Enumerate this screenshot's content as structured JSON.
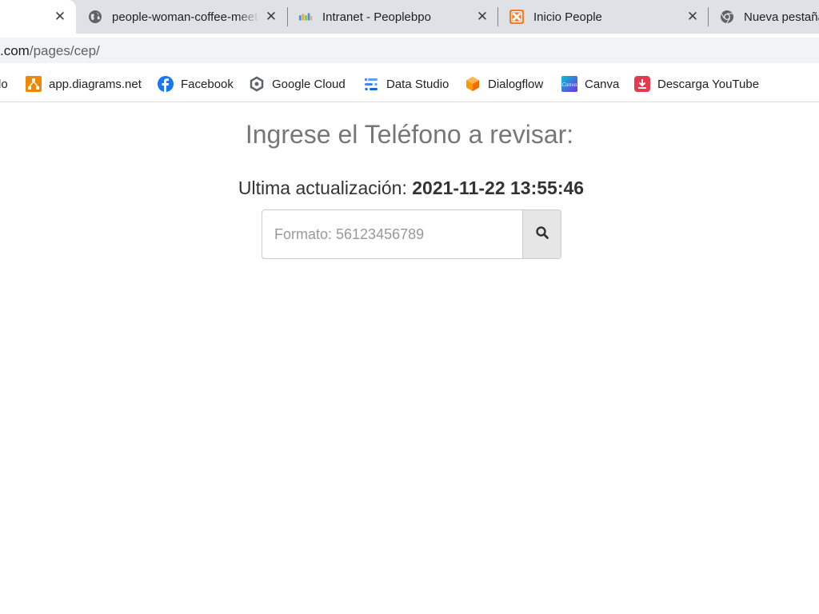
{
  "tabs": [
    {
      "title": "",
      "close": "✕"
    },
    {
      "title": "people-woman-coffee-meeting",
      "close": "✕"
    },
    {
      "title": "Intranet - Peoplebpo",
      "close": "✕"
    },
    {
      "title": "Inicio People",
      "close": "✕"
    },
    {
      "title": "Nueva pestaña",
      "close": ""
    }
  ],
  "address_bar": {
    "host": ".com",
    "path": "/pages/cep/"
  },
  "bookmarks": [
    {
      "label": "lo",
      "icon": "partial-bookmark-icon"
    },
    {
      "label": "app.diagrams.net",
      "icon": "diagrams-icon"
    },
    {
      "label": "Facebook",
      "icon": "facebook-icon"
    },
    {
      "label": "Google Cloud",
      "icon": "google-cloud-icon"
    },
    {
      "label": "Data Studio",
      "icon": "data-studio-icon"
    },
    {
      "label": "Dialogflow",
      "icon": "dialogflow-icon"
    },
    {
      "label": "Canva",
      "icon": "canva-icon"
    },
    {
      "label": "Descarga YouTube",
      "icon": "youtube-download-icon"
    }
  ],
  "page": {
    "heading": "Ingrese el Teléfono a revisar:",
    "updated_label": "Ultima actualización:",
    "updated_value": "2021-11-22 13:55:46",
    "search": {
      "placeholder": "Formato: 56123456789",
      "value": ""
    }
  },
  "colors": {
    "tabstrip": "#dee1e6",
    "omnibox": "#f1f3f4",
    "heading": "#777777",
    "button": "#e6e6e6"
  }
}
